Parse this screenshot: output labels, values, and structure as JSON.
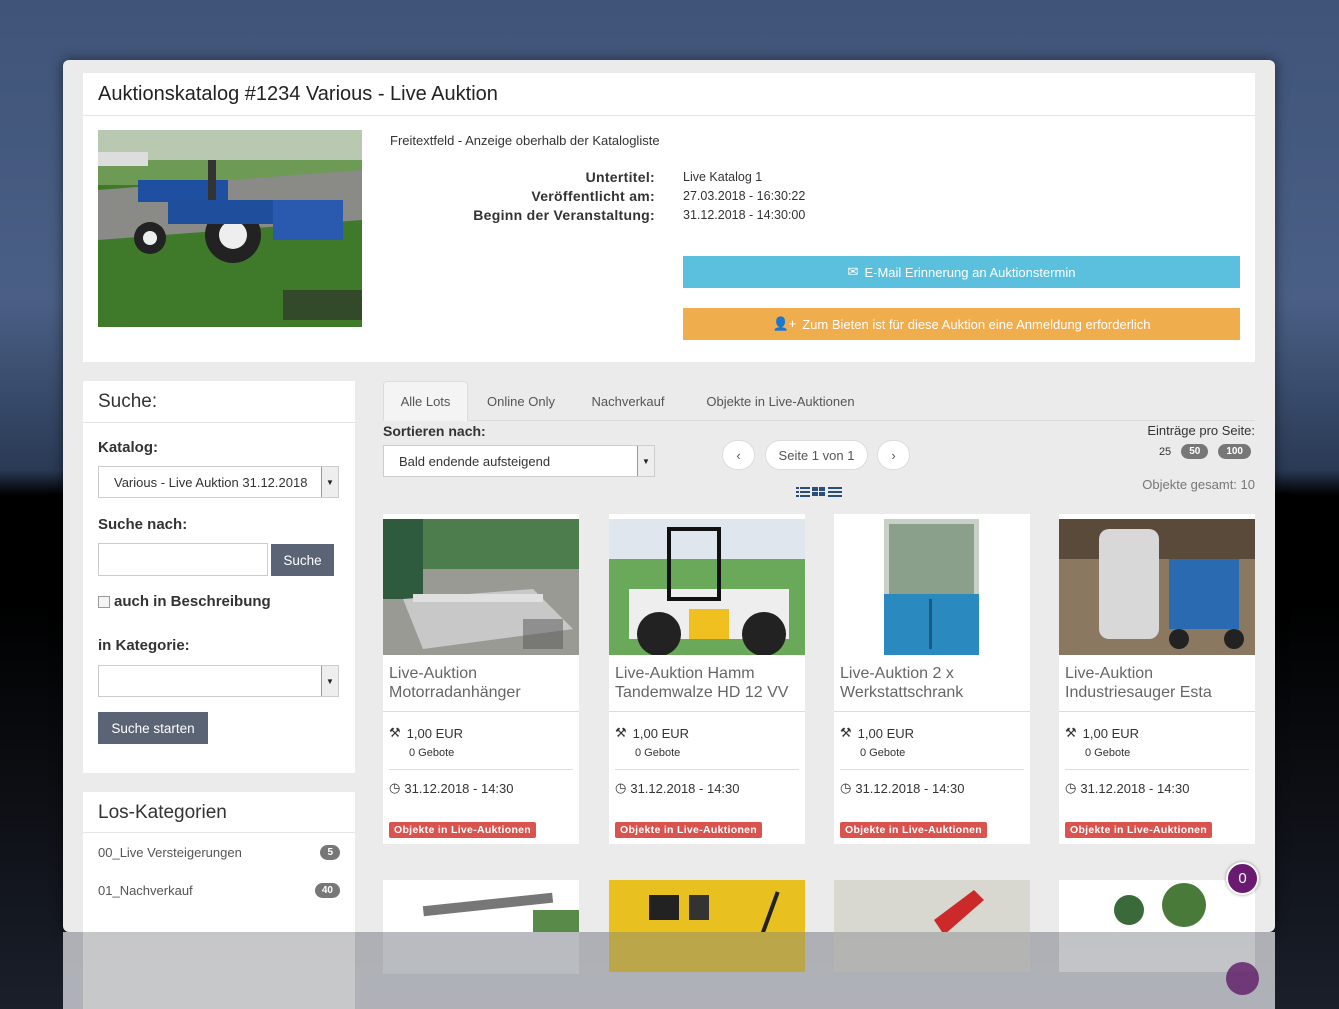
{
  "header": {
    "title": "Auktionskatalog #1234 Various - Live Auktion",
    "freetext": "Freitextfeld - Anzeige oberhalb der Katalogliste",
    "meta": [
      {
        "label": "Untertitel:",
        "value": "Live Katalog 1"
      },
      {
        "label": "Veröffentlicht am:",
        "value": "27.03.2018 - 16:30:22"
      },
      {
        "label": "Beginn der Veranstaltung:",
        "value": "31.12.2018 - 14:30:00"
      }
    ],
    "email_button": "E-Mail Erinnerung an Auktionstermin",
    "login_button": "Zum Bieten ist für diese Auktion eine Anmeldung erforderlich"
  },
  "search": {
    "title": "Suche:",
    "catalog_label": "Katalog:",
    "catalog_value": "Various - Live Auktion 31.12.2018",
    "search_for_label": "Suche nach:",
    "search_button": "Suche",
    "in_description_label": "auch in Beschreibung",
    "category_label": "in Kategorie:",
    "start_button": "Suche starten"
  },
  "categories": {
    "title": "Los-Kategorien",
    "items": [
      {
        "label": "00_Live Versteigerungen",
        "count": "5"
      },
      {
        "label": "01_Nachverkauf",
        "count": "40"
      }
    ]
  },
  "tabs": [
    "Alle Lots",
    "Online Only",
    "Nachverkauf",
    "Objekte in Live-Auktionen"
  ],
  "sort": {
    "label": "Sortieren nach:",
    "value": "Bald endende aufsteigend"
  },
  "pager": {
    "prev": "‹",
    "page_text": "Seite 1 von 1",
    "next": "›"
  },
  "per_page": {
    "label": "Einträge pro Seite:",
    "options": [
      "25",
      "50",
      "100"
    ]
  },
  "total": "Objekte gesamt: 10",
  "lots": [
    {
      "title_line1": "Live-Auktion",
      "title_line2": "Motorradanhänger",
      "price": "1,00 EUR",
      "bids": "0 Gebote",
      "date": "31.12.2018 - 14:30",
      "badge": "Objekte in Live-Auktionen"
    },
    {
      "title_line1": "Live-Auktion Hamm",
      "title_line2": "Tandemwalze HD 12 VV",
      "price": "1,00 EUR",
      "bids": "0 Gebote",
      "date": "31.12.2018 - 14:30",
      "badge": "Objekte in Live-Auktionen"
    },
    {
      "title_line1": "Live-Auktion 2 x",
      "title_line2": "Werkstattschrank",
      "price": "1,00 EUR",
      "bids": "0 Gebote",
      "date": "31.12.2018 - 14:30",
      "badge": "Objekte in Live-Auktionen"
    },
    {
      "title_line1": "Live-Auktion",
      "title_line2": "Industriesauger Esta",
      "price": "1,00 EUR",
      "bids": "0 Gebote",
      "date": "31.12.2018 - 14:30",
      "badge": "Objekte in Live-Auktionen"
    }
  ],
  "cart_count": "0",
  "colors": {
    "info": "#5bc0de",
    "warning": "#f0ad4e",
    "danger": "#d9534f",
    "cart": "#6a1a70"
  }
}
